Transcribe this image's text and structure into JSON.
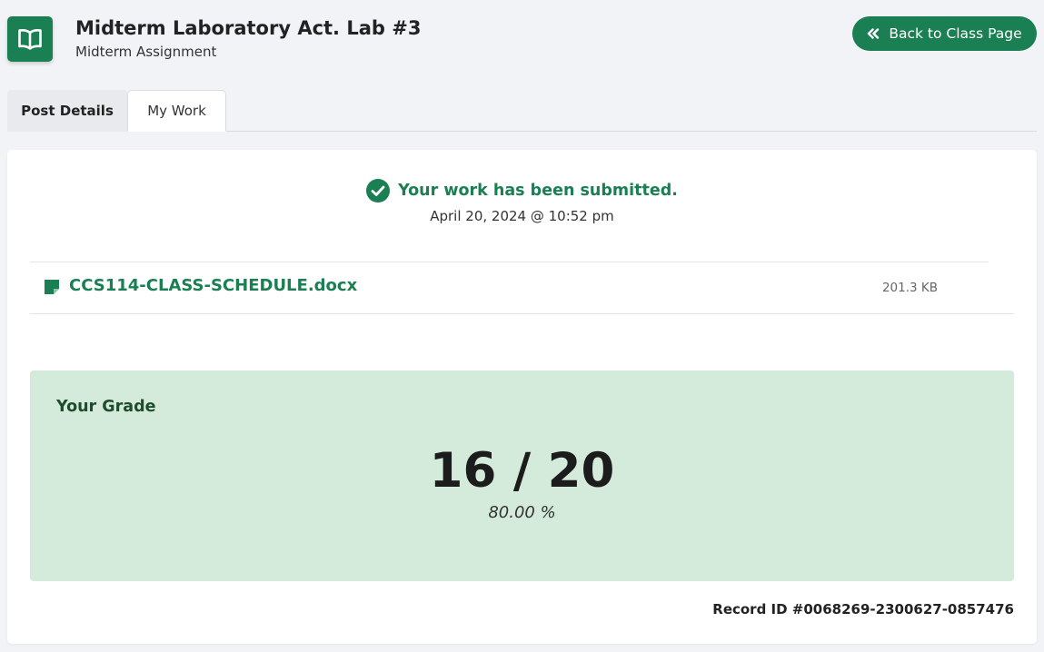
{
  "header": {
    "title": "Midterm Laboratory Act. Lab #3",
    "subtitle": "Midterm Assignment",
    "back_button_label": "Back to Class Page",
    "app_icon": "open-book-icon"
  },
  "tabs": [
    {
      "label": "Post Details",
      "active": false
    },
    {
      "label": "My Work",
      "active": true
    }
  ],
  "submission": {
    "status_text": "Your work has been submitted.",
    "timestamp": "April 20, 2024 @ 10:52 pm",
    "status_icon": "check-circle-icon"
  },
  "files": [
    {
      "name": "CCS114-CLASS-SCHEDULE.docx",
      "size": "201.3 KB",
      "icon": "file-icon"
    }
  ],
  "grade": {
    "label": "Your Grade",
    "score": "16 / 20",
    "percent": "80.00 %"
  },
  "record_id": "Record ID #0068269-2300627-0857476",
  "colors": {
    "accent": "#1a7f52",
    "grade_background": "#d4ebdc",
    "page_background": "#f2f3f7"
  }
}
